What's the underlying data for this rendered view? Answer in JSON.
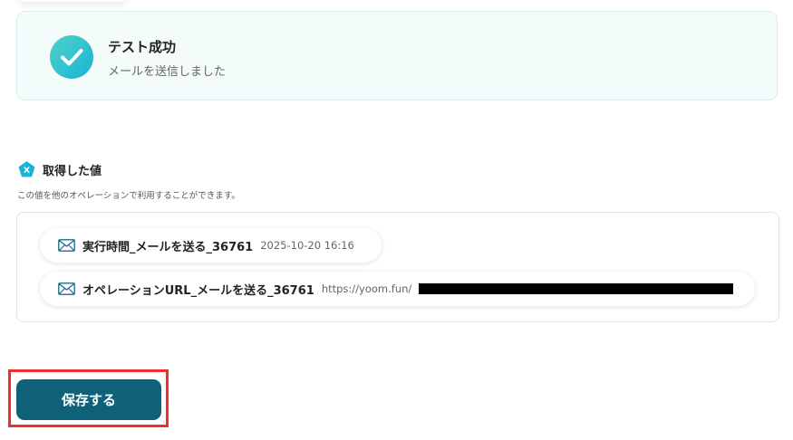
{
  "test_result": {
    "title": "テスト成功",
    "message": "メールを送信しました"
  },
  "retrieved_values": {
    "title": "取得した値",
    "description": "この値を他のオペレーションで利用することができます。",
    "items": [
      {
        "label": "実行時間_メールを送る_36761",
        "value": "2025-10-20 16:16"
      },
      {
        "label": "オペレーションURL_メールを送る_36761",
        "value": "https://yoom.fun/"
      }
    ]
  },
  "actions": {
    "save_label": "保存する"
  },
  "colors": {
    "accent": "#0f6079",
    "success_gradient_start": "#4fd3c8",
    "success_gradient_end": "#19b3d6",
    "highlight": "#ef2d2d"
  },
  "icons": {
    "success": "check-circle-icon",
    "values_badge": "variable-x-icon",
    "item": "mail-icon"
  }
}
